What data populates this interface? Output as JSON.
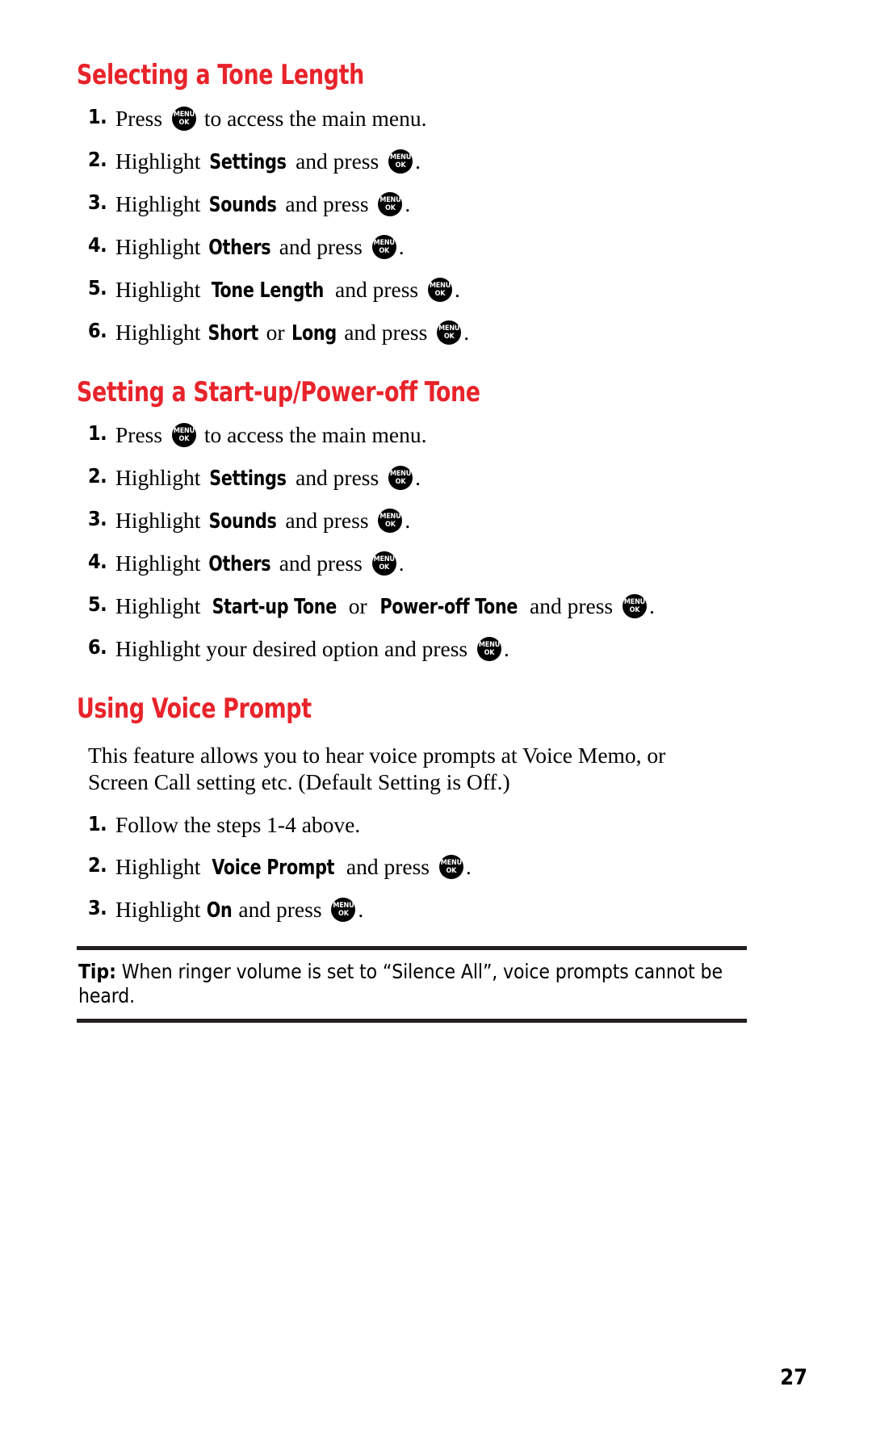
{
  "page": {
    "number": "27",
    "accent_color": "#e8232a",
    "rule_color": "#231f20"
  },
  "key_icon": {
    "line1": "MENU",
    "line2": "OK",
    "name": "menu-ok-key-icon"
  },
  "sections": [
    {
      "heading": "Selecting a Tone Length",
      "steps": [
        {
          "num": "1.",
          "pre": "Press ",
          "term": "",
          "mid": "",
          "term2": "",
          "post": " to access the main menu.",
          "icon_after_pre": true,
          "trailing_period": false
        },
        {
          "num": "2.",
          "pre": "Highlight ",
          "term": "Settings",
          "mid": " and press ",
          "term2": "",
          "post": ".",
          "icon_after_pre": false,
          "trailing_period": true
        },
        {
          "num": "3.",
          "pre": "Highlight ",
          "term": "Sounds",
          "mid": " and press ",
          "term2": "",
          "post": ".",
          "icon_after_pre": false,
          "trailing_period": true
        },
        {
          "num": "4.",
          "pre": "Highlight ",
          "term": "Others",
          "mid": " and press ",
          "term2": "",
          "post": ".",
          "icon_after_pre": false,
          "trailing_period": true
        },
        {
          "num": "5.",
          "pre": "Highlight ",
          "term": "Tone Length",
          "mid": " and press ",
          "term2": "",
          "post": ".",
          "icon_after_pre": false,
          "trailing_period": true
        },
        {
          "num": "6.",
          "pre": "Highlight ",
          "term": "Short",
          "mid": " or ",
          "term2": "Long",
          "post": " and press ",
          "icon_after_pre": false,
          "trailing_period": true
        }
      ]
    },
    {
      "heading": "Setting a Start-up/Power-off Tone",
      "steps": [
        {
          "num": "1.",
          "pre": "Press ",
          "term": "",
          "mid": "",
          "term2": "",
          "post": " to access the main menu.",
          "icon_after_pre": true,
          "trailing_period": false
        },
        {
          "num": "2.",
          "pre": "Highlight ",
          "term": "Settings",
          "mid": " and press ",
          "term2": "",
          "post": ".",
          "icon_after_pre": false,
          "trailing_period": true
        },
        {
          "num": "3.",
          "pre": "Highlight ",
          "term": "Sounds",
          "mid": " and press ",
          "term2": "",
          "post": ".",
          "icon_after_pre": false,
          "trailing_period": true
        },
        {
          "num": "4.",
          "pre": "Highlight ",
          "term": "Others",
          "mid": " and press ",
          "term2": "",
          "post": ".",
          "icon_after_pre": false,
          "trailing_period": true
        },
        {
          "num": "5.",
          "pre": "Highlight ",
          "term": "Start-up Tone",
          "mid": " or ",
          "term2": "Power-off Tone",
          "post": " and press ",
          "icon_after_pre": false,
          "trailing_period": true
        },
        {
          "num": "6.",
          "pre": "Highlight your desired option and press ",
          "term": "",
          "mid": "",
          "term2": "",
          "post": "",
          "icon_after_pre": true,
          "trailing_period": true
        }
      ]
    },
    {
      "heading": "Using Voice Prompt",
      "paragraph_lines": [
        "This feature allows you to hear voice prompts at Voice Memo, or",
        "Screen Call setting etc. (Default Setting is Off.)"
      ],
      "steps": [
        {
          "num": "1.",
          "pre": "Follow the steps 1-4 above.",
          "term": "",
          "mid": "",
          "term2": "",
          "post": "",
          "icon_after_pre": false,
          "trailing_period": false
        },
        {
          "num": "2.",
          "pre": "Highlight ",
          "term": "Voice Prompt",
          "mid": " and press ",
          "term2": "",
          "post": ".",
          "icon_after_pre": false,
          "trailing_period": true
        },
        {
          "num": "3.",
          "pre": "Highlight ",
          "term": "On",
          "mid": " and press ",
          "term2": "",
          "post": ".",
          "icon_after_pre": false,
          "trailing_period": true
        }
      ]
    }
  ],
  "tip": {
    "label": "Tip:",
    "text": " When ringer volume is set to “Silence All”, voice prompts cannot be heard."
  }
}
